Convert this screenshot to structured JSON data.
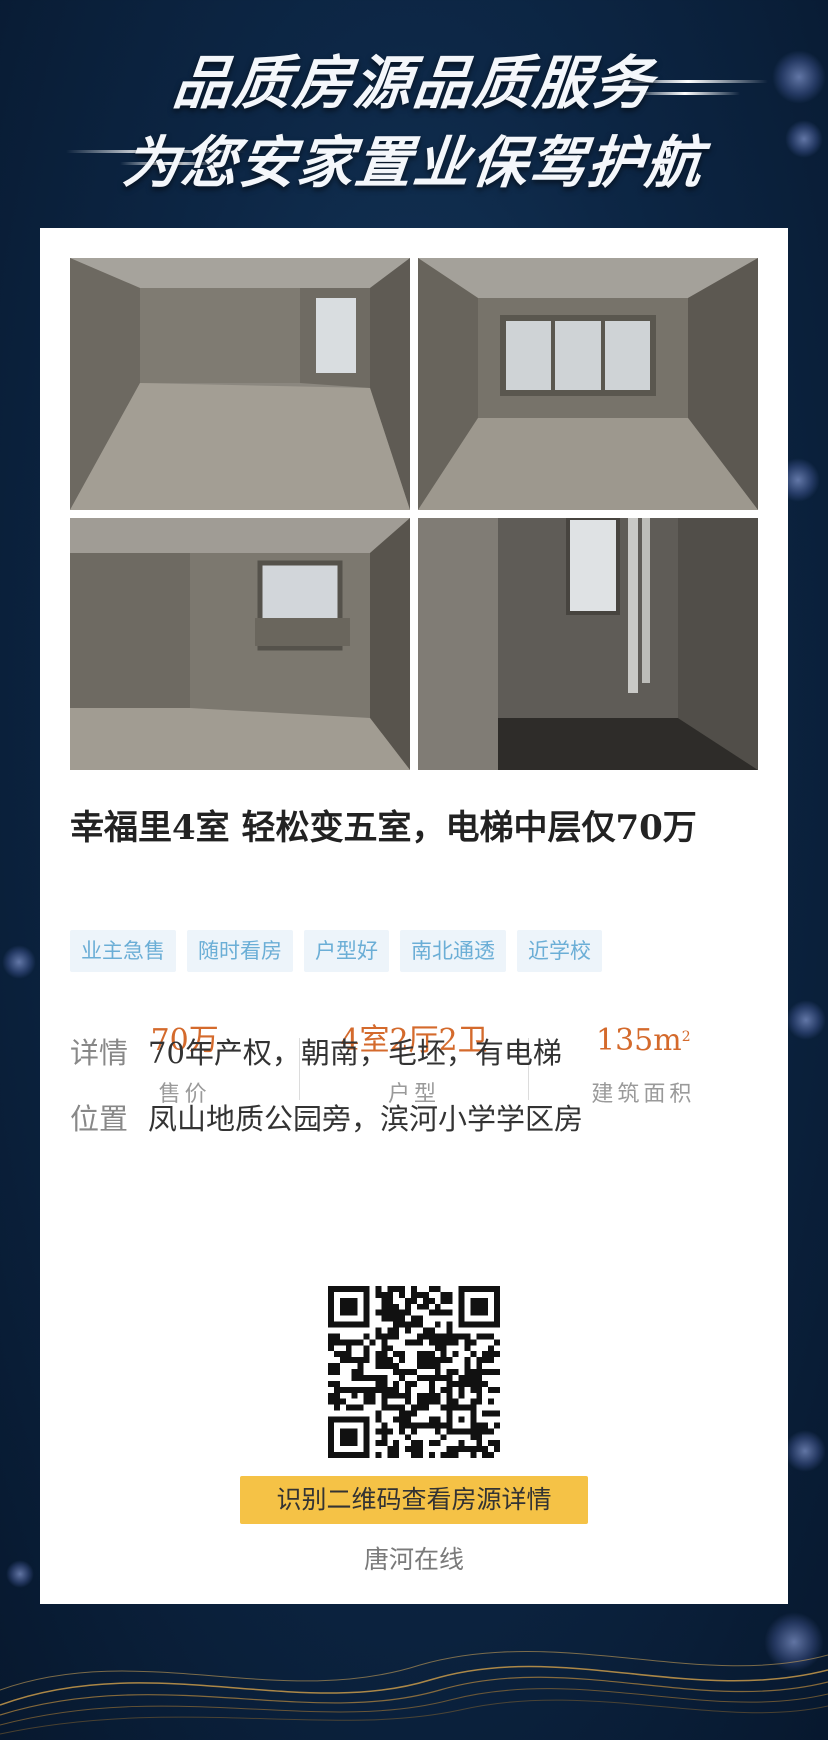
{
  "hero": {
    "line1": "品质房源品质服务",
    "line2": "为您安家置业保驾护航"
  },
  "listing": {
    "title": "幸福里4室 轻松变五室，电梯中层仅70万",
    "tags": [
      "业主急售",
      "随时看房",
      "户型好",
      "南北通透",
      "近学校"
    ],
    "stats": [
      {
        "value": "70万",
        "label": "售价"
      },
      {
        "value": "4室2厅2卫",
        "label": "户型"
      },
      {
        "value": "135m",
        "sup": "2",
        "label": "建筑面积"
      }
    ],
    "details": {
      "key": "详情",
      "value": "70年产权，朝南，毛坯，有电梯"
    },
    "location": {
      "key": "位置",
      "value": "凤山地质公园旁，滨河小学学区房"
    },
    "photos": [
      "living-room",
      "bedroom-bay-window",
      "bedroom-window",
      "bathroom"
    ]
  },
  "cta": "识别二维码查看房源详情",
  "brand": "唐河在线",
  "colors": {
    "background": "#0d2746",
    "price_accent": "#d46a2c",
    "tag_bg": "#edf4fa",
    "tag_text": "#6baed6",
    "cta_bg": "#f5c246"
  }
}
